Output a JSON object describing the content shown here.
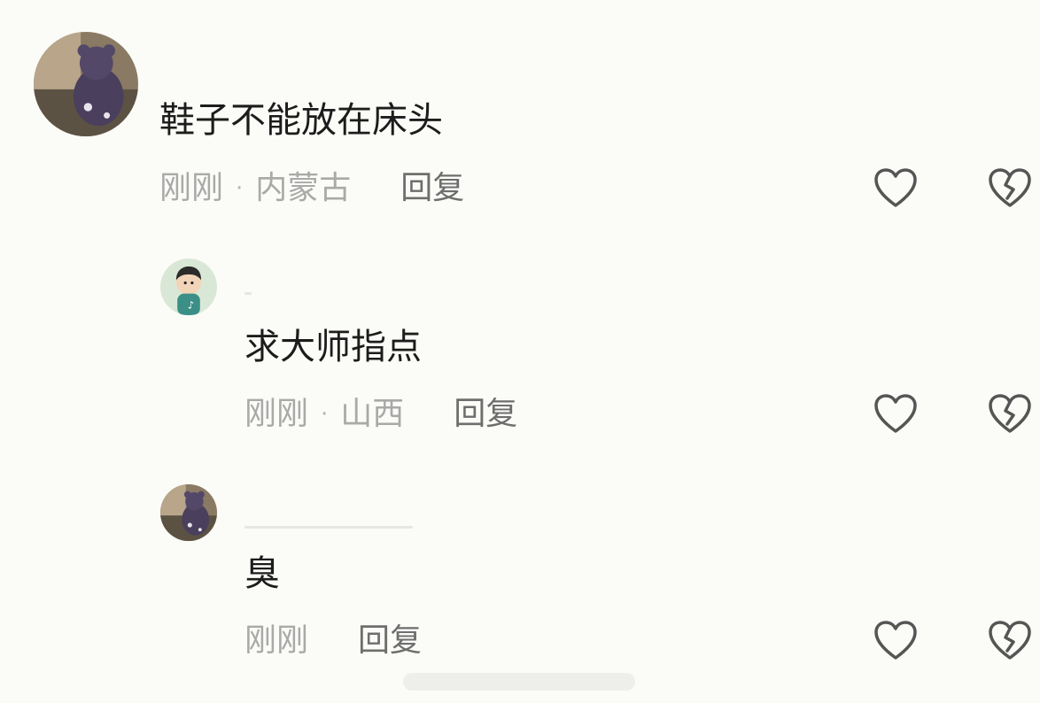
{
  "comments": [
    {
      "text": "鞋子不能放在床头",
      "time": "刚刚",
      "location": "内蒙古",
      "reply_label": "回复"
    },
    {
      "text": "求大师指点",
      "time": "刚刚",
      "location": "山西",
      "reply_label": "回复"
    },
    {
      "text": "臭",
      "time": "刚刚",
      "reply_label": "回复"
    }
  ],
  "icons": {
    "like": "heart-outline-icon",
    "dislike": "broken-heart-icon"
  },
  "colors": {
    "background": "#fbfbf7",
    "text": "#1c1c1c",
    "meta": "#a9a9a9",
    "reply": "#6e6e6e",
    "icon": "#555555"
  }
}
